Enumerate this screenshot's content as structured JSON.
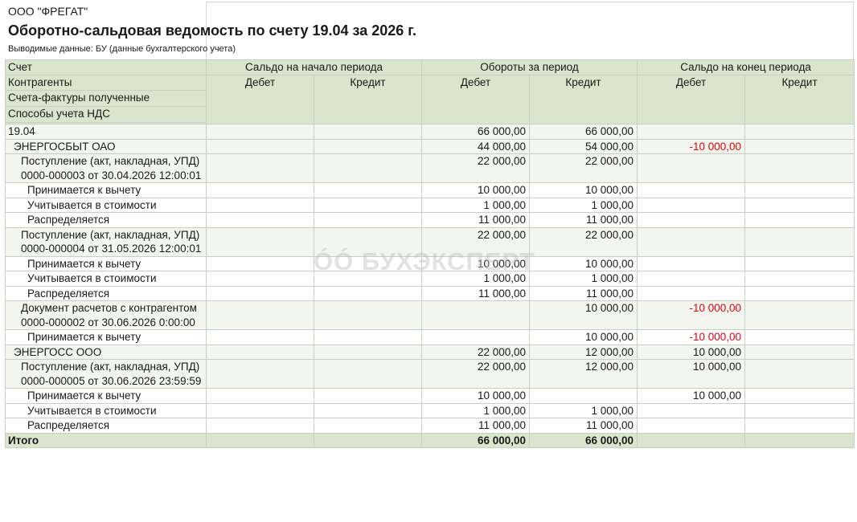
{
  "header": {
    "org": "ООО \"ФРЕГАТ\"",
    "title": "Оборотно-сальдовая ведомость по счету 19.04 за 2026 г.",
    "subtitle": "Выводимые данные: БУ (данные бухгалтерского учета)"
  },
  "columns": {
    "account": "Счет",
    "contragents": "Контрагенты",
    "invoices": "Счета-фактуры полученные",
    "vat_methods": "Способы учета НДС",
    "opening": "Сальдо на начало периода",
    "turnover": "Обороты за период",
    "closing": "Сальдо на конец периода",
    "debit": "Дебет",
    "credit": "Кредит"
  },
  "watermark": "БУХЭКСПЕРТ",
  "rows": [
    {
      "label": "19.04",
      "level": 0,
      "od": "",
      "oc": "",
      "td": "66 000,00",
      "tc": "66 000,00",
      "cd": "",
      "cc": ""
    },
    {
      "label": "ЭНЕРГОСБЫТ ОАО",
      "level": 1,
      "od": "",
      "oc": "",
      "td": "44 000,00",
      "tc": "54 000,00",
      "cd": "-10 000,00",
      "cc": ""
    },
    {
      "label": "Поступление (акт, накладная, УПД) 0000-000003 от 30.04.2026 12:00:01",
      "level": 2,
      "od": "",
      "oc": "",
      "td": "22 000,00",
      "tc": "22 000,00",
      "cd": "",
      "cc": ""
    },
    {
      "label": "Принимается к вычету",
      "level": 3,
      "od": "",
      "oc": "",
      "td": "10 000,00",
      "tc": "10 000,00",
      "cd": "",
      "cc": ""
    },
    {
      "label": "Учитывается в стоимости",
      "level": 3,
      "od": "",
      "oc": "",
      "td": "1 000,00",
      "tc": "1 000,00",
      "cd": "",
      "cc": ""
    },
    {
      "label": "Распределяется",
      "level": 3,
      "od": "",
      "oc": "",
      "td": "11 000,00",
      "tc": "11 000,00",
      "cd": "",
      "cc": ""
    },
    {
      "label": "Поступление (акт, накладная, УПД) 0000-000004 от 31.05.2026 12:00:01",
      "level": 2,
      "od": "",
      "oc": "",
      "td": "22 000,00",
      "tc": "22 000,00",
      "cd": "",
      "cc": ""
    },
    {
      "label": "Принимается к вычету",
      "level": 3,
      "od": "",
      "oc": "",
      "td": "10 000,00",
      "tc": "10 000,00",
      "cd": "",
      "cc": ""
    },
    {
      "label": "Учитывается в стоимости",
      "level": 3,
      "od": "",
      "oc": "",
      "td": "1 000,00",
      "tc": "1 000,00",
      "cd": "",
      "cc": ""
    },
    {
      "label": "Распределяется",
      "level": 3,
      "od": "",
      "oc": "",
      "td": "11 000,00",
      "tc": "11 000,00",
      "cd": "",
      "cc": ""
    },
    {
      "label": "Документ расчетов с контрагентом 0000-000002 от 30.06.2026 0:00:00",
      "level": 2,
      "od": "",
      "oc": "",
      "td": "",
      "tc": "10 000,00",
      "cd": "-10 000,00",
      "cc": ""
    },
    {
      "label": "Принимается к вычету",
      "level": 3,
      "od": "",
      "oc": "",
      "td": "",
      "tc": "10 000,00",
      "cd": "-10 000,00",
      "cc": ""
    },
    {
      "label": "ЭНЕРГОСС ООО",
      "level": 1,
      "od": "",
      "oc": "",
      "td": "22 000,00",
      "tc": "12 000,00",
      "cd": "10 000,00",
      "cc": ""
    },
    {
      "label": "Поступление (акт, накладная, УПД) 0000-000005 от 30.06.2026 23:59:59",
      "level": 2,
      "od": "",
      "oc": "",
      "td": "22 000,00",
      "tc": "12 000,00",
      "cd": "10 000,00",
      "cc": ""
    },
    {
      "label": "Принимается к вычету",
      "level": 3,
      "od": "",
      "oc": "",
      "td": "10 000,00",
      "tc": "",
      "cd": "10 000,00",
      "cc": ""
    },
    {
      "label": "Учитывается в стоимости",
      "level": 3,
      "od": "",
      "oc": "",
      "td": "1 000,00",
      "tc": "1 000,00",
      "cd": "",
      "cc": ""
    },
    {
      "label": "Распределяется",
      "level": 3,
      "od": "",
      "oc": "",
      "td": "11 000,00",
      "tc": "11 000,00",
      "cd": "",
      "cc": ""
    }
  ],
  "total": {
    "label": "Итого",
    "od": "",
    "oc": "",
    "td": "66 000,00",
    "tc": "66 000,00",
    "cd": "",
    "cc": ""
  }
}
